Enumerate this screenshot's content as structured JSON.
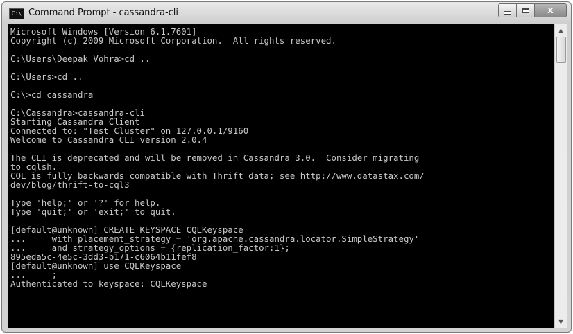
{
  "window": {
    "title": "Command Prompt - cassandra-cli",
    "app_icon": "cmd-icon",
    "app_icon_text": "C:\\",
    "controls": {
      "minimize": "minimize-icon",
      "maximize": "maximize-icon",
      "close": "close-icon",
      "close_label": "X"
    }
  },
  "console": {
    "lines": [
      "Microsoft Windows [Version 6.1.7601]",
      "Copyright (c) 2009 Microsoft Corporation.  All rights reserved.",
      "",
      "C:\\Users\\Deepak Vohra>cd ..",
      "",
      "C:\\Users>cd ..",
      "",
      "C:\\>cd cassandra",
      "",
      "C:\\Cassandra>cassandra-cli",
      "Starting Cassandra Client",
      "Connected to: \"Test Cluster\" on 127.0.0.1/9160",
      "Welcome to Cassandra CLI version 2.0.4",
      "",
      "The CLI is deprecated and will be removed in Cassandra 3.0.  Consider migrating",
      "to cqlsh.",
      "CQL is fully backwards compatible with Thrift data; see http://www.datastax.com/",
      "dev/blog/thrift-to-cql3",
      "",
      "Type 'help;' or '?' for help.",
      "Type 'quit;' or 'exit;' to quit.",
      "",
      "[default@unknown] CREATE KEYSPACE CQLKeyspace",
      "...     with placement_strategy = 'org.apache.cassandra.locator.SimpleStrategy'",
      "...     and strategy_options = {replication_factor:1};",
      "895eda5c-4e5c-3dd3-b171-c6064b11fef8",
      "[default@unknown] use CQLKeyspace",
      "...     ;",
      "Authenticated to keyspace: CQLKeyspace"
    ]
  },
  "scrollbar": {
    "up": "scroll-up-arrow-icon",
    "down": "scroll-down-arrow-icon",
    "up_glyph": "▲",
    "down_glyph": "▼"
  }
}
